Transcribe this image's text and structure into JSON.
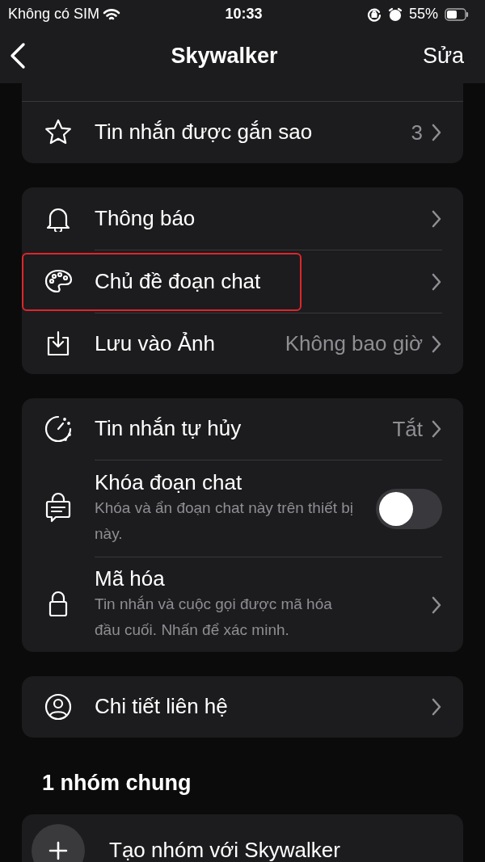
{
  "status_bar": {
    "carrier": "Không có SIM",
    "time": "10:33",
    "battery": "55%"
  },
  "nav": {
    "title": "Skywalker",
    "edit": "Sửa"
  },
  "groups": [
    {
      "cut_top": true,
      "rows": [
        {
          "kind": "link",
          "label": "Tin nhắn được gắn sao",
          "value": "3",
          "highlighted": false
        }
      ]
    },
    {
      "rows": [
        {
          "kind": "link",
          "label": "Thông báo",
          "highlighted": false
        },
        {
          "kind": "link",
          "label": "Chủ đề đoạn chat",
          "highlighted": true
        },
        {
          "kind": "link",
          "label": "Lưu vào Ảnh",
          "value": "Không bao giờ",
          "highlighted": false
        }
      ]
    },
    {
      "rows": [
        {
          "kind": "link",
          "label": "Tin nhắn tự hủy",
          "value": "Tắt",
          "highlighted": false
        },
        {
          "kind": "toggle",
          "label": "Khóa đoạn chat",
          "subtitle": "Khóa và ẩn đoạn chat này trên thiết bị này.",
          "on": false
        },
        {
          "kind": "detail",
          "label": "Mã hóa",
          "subtitle": "Tin nhắn và cuộc gọi được mã hóa đầu cuối. Nhấn để xác minh."
        }
      ]
    },
    {
      "rows": [
        {
          "kind": "link",
          "label": "Chi tiết liên hệ",
          "highlighted": false
        }
      ]
    }
  ],
  "section": {
    "title": "1 nhóm chung",
    "rows": [
      {
        "kind": "add",
        "label": "Tạo nhóm với Skywalker"
      }
    ]
  }
}
